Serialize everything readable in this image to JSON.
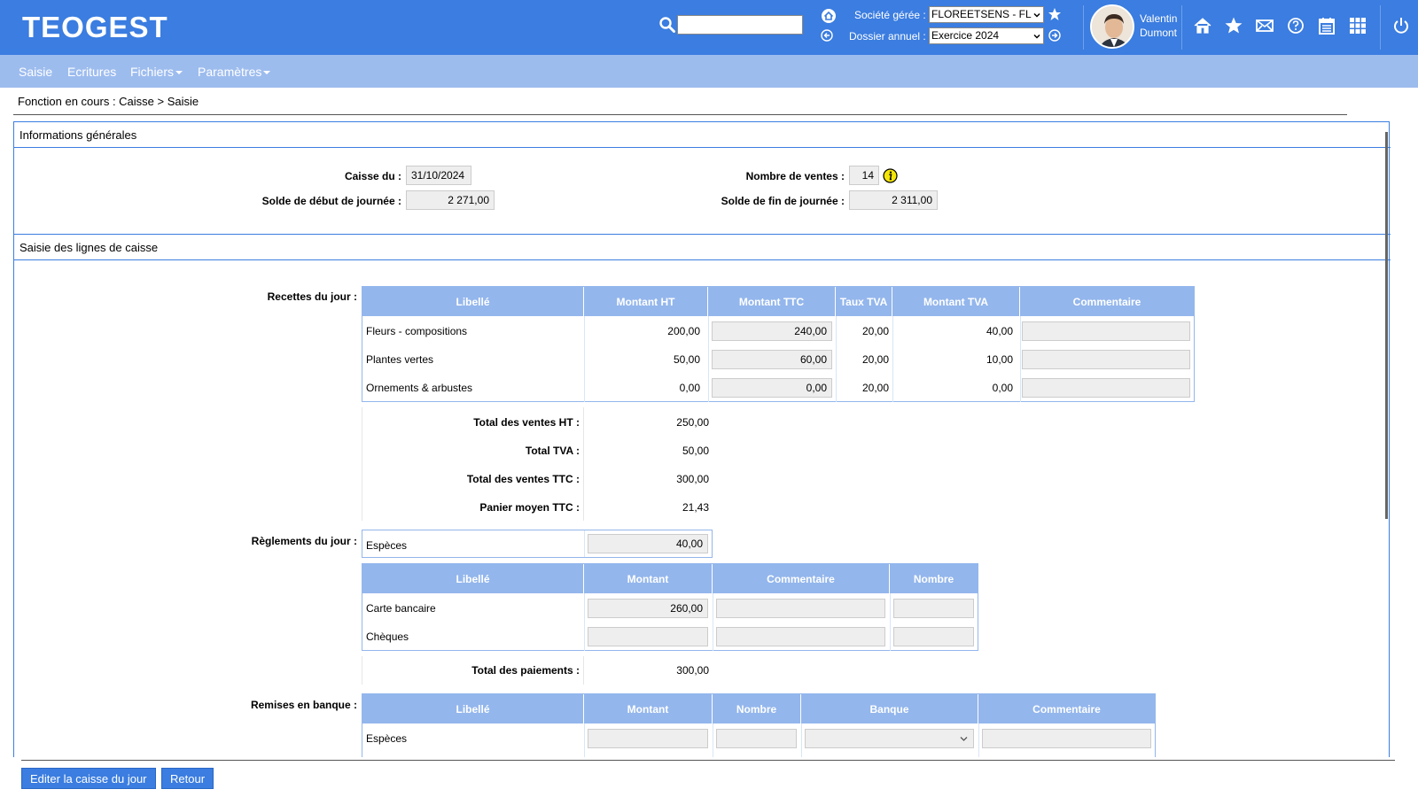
{
  "header": {
    "logo": "TEOGEST",
    "societe_label": "Société gérée :",
    "societe_value": "FLOREETSENS - FL",
    "dossier_label": "Dossier annuel :",
    "dossier_value": "Exercice 2024",
    "user_first": "Valentin",
    "user_last": "Dumont"
  },
  "menu": {
    "saisie": "Saisie",
    "ecritures": "Ecritures",
    "fichiers": "Fichiers",
    "parametres": "Paramètres"
  },
  "breadcrumb": "Fonction en cours :  Caisse > Saisie",
  "general": {
    "title": "Informations générales",
    "caisse_du_label": "Caisse du :",
    "caisse_du_value": "31/10/2024",
    "solde_debut_label": "Solde de début de journée :",
    "solde_debut_value": "2 271,00",
    "nb_ventes_label": "Nombre de ventes :",
    "nb_ventes_value": "14",
    "solde_fin_label": "Solde de fin de journée :",
    "solde_fin_value": "2 311,00"
  },
  "saisie": {
    "title": "Saisie des lignes de caisse",
    "recettes_label": "Recettes du jour :",
    "recettes_headers": [
      "Libellé",
      "Montant HT",
      "Montant TTC",
      "Taux TVA",
      "Montant TVA",
      "Commentaire"
    ],
    "recettes_rows": [
      {
        "libelle": "Fleurs - compositions",
        "ht": "200,00",
        "ttc": "240,00",
        "taux": "20,00",
        "tva": "40,00"
      },
      {
        "libelle": "Plantes vertes",
        "ht": "50,00",
        "ttc": "60,00",
        "taux": "20,00",
        "tva": "10,00"
      },
      {
        "libelle": "Ornements & arbustes",
        "ht": "0,00",
        "ttc": "0,00",
        "taux": "20,00",
        "tva": "0,00"
      }
    ],
    "totals": {
      "ventes_ht_label": "Total des ventes HT :",
      "ventes_ht_value": "250,00",
      "tva_label": "Total TVA :",
      "tva_value": "50,00",
      "ventes_ttc_label": "Total des ventes TTC :",
      "ventes_ttc_value": "300,00",
      "panier_label": "Panier moyen TTC :",
      "panier_value": "21,43"
    },
    "reglements_label": "Règlements du jour :",
    "especes_label": "Espèces",
    "especes_value": "40,00",
    "reglements_headers": [
      "Libellé",
      "Montant",
      "Commentaire",
      "Nombre"
    ],
    "reglements_rows": [
      {
        "libelle": "Carte bancaire",
        "montant": "260,00"
      },
      {
        "libelle": "Chèques",
        "montant": ""
      }
    ],
    "total_paiements_label": "Total des paiements :",
    "total_paiements_value": "300,00",
    "remises_label": "Remises en banque :",
    "remises_headers": [
      "Libellé",
      "Montant",
      "Nombre",
      "Banque",
      "Commentaire"
    ],
    "remises_rows": [
      {
        "libelle": "Espèces"
      }
    ]
  },
  "buttons": {
    "editer": "Editer la caisse du jour",
    "retour": "Retour"
  },
  "colors": {
    "primary": "#3b7de0",
    "menu_bar": "#9dbcee",
    "grid_header": "#93b6ec",
    "info_icon": "#f5e60a"
  }
}
